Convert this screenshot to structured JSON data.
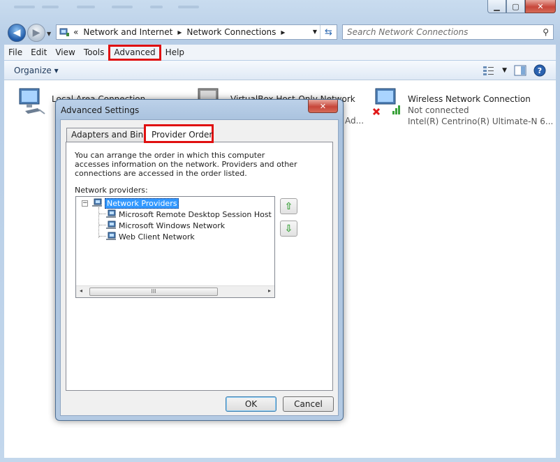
{
  "window": {
    "min_glyph": "▁",
    "max_glyph": "▢",
    "close_glyph": "✕"
  },
  "address_bar": {
    "chevrons": "«",
    "crumbs": [
      "Network and Internet",
      "Network Connections"
    ],
    "sep": "▸",
    "search_placeholder": "Search Network Connections"
  },
  "menu": {
    "items": [
      "File",
      "Edit",
      "View",
      "Tools",
      "Advanced",
      "Help"
    ]
  },
  "command_bar": {
    "organize": "Organize",
    "help_glyph": "?"
  },
  "connections": [
    {
      "title": "Local Area Connection",
      "line2": "",
      "line3": ""
    },
    {
      "title": "VirtualBox Host-Only Network",
      "line2": "",
      "line3": "Ad..."
    },
    {
      "title": "Wireless Network Connection",
      "line2": "Not connected",
      "line3": "Intel(R) Centrino(R) Ultimate-N 6..."
    }
  ],
  "dialog": {
    "title": "Advanced Settings",
    "close_glyph": "✕",
    "tabs": [
      "Adapters and Bindings",
      "Provider Order"
    ],
    "description": "You can arrange the order in which this computer accesses information on the network.  Providers and other connections are accessed in the order listed.",
    "providers_label": "Network providers:",
    "tree_root": "Network Providers",
    "tree_children": [
      "Microsoft Remote Desktop Session Host Server",
      "Microsoft Windows Network",
      "Web Client Network"
    ],
    "expander": "−",
    "scroll_left": "◂",
    "scroll_right": "▸",
    "scroll_grip": "III",
    "up_glyph": "⇧",
    "down_glyph": "⇩",
    "ok_label": "OK",
    "cancel_label": "Cancel"
  },
  "colors": {
    "highlight_red": "#e01010",
    "selection_blue": "#3399ff"
  }
}
